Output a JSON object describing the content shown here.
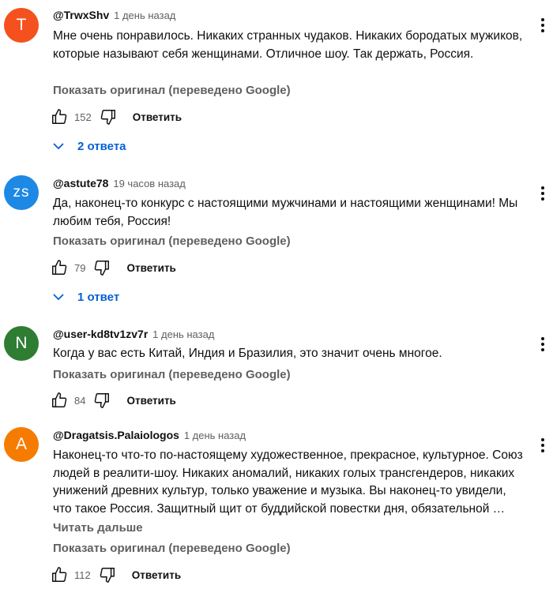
{
  "colors": {
    "link": "#065fd4",
    "muted": "#606060",
    "text": "#0f0f0f"
  },
  "icons": [
    "like-icon",
    "dislike-icon",
    "chevron-down-icon",
    "more-vert-icon"
  ],
  "comments": [
    {
      "avatar_letter": "T",
      "avatar_color": "#f4511e",
      "author": "@TrwxShv",
      "time": "1 день назад",
      "text": "Мне очень понравилось. Никаких странных чудаков. Никаких бородатых мужиков, которые называют себя женщинами. Отличное шоу. Так держать, Россия.",
      "read_more": "",
      "translate": "Показать оригинал (переведено Google)",
      "likes": "152",
      "reply": "Ответить",
      "replies": "2 ответа"
    },
    {
      "avatar_letter": "zs",
      "avatar_color": "#1e88e5",
      "author": "@astute78",
      "time": "19 часов назад",
      "text": "Да, наконец-то конкурс с настоящими мужчинами и настоящими женщинами! Мы любим тебя, Россия!",
      "read_more": "",
      "translate": "Показать оригинал (переведено Google)",
      "likes": "79",
      "reply": "Ответить",
      "replies": "1 ответ"
    },
    {
      "avatar_letter": "N",
      "avatar_color": "#2e7d32",
      "author": "@user-kd8tv1zv7r",
      "time": "1 день назад",
      "text": "Когда у вас есть Китай, Индия и Бразилия, это значит очень многое.",
      "read_more": "",
      "translate": "Показать оригинал (переведено Google)",
      "likes": "84",
      "reply": "Ответить",
      "replies": ""
    },
    {
      "avatar_letter": "A",
      "avatar_color": "#f57c00",
      "author": "@Dragatsis.Palaiologos",
      "time": "1 день назад",
      "text": "Наконец-то что-то по-настоящему художественное, прекрасное, культурное. Союз людей в реалити-шоу. Никаких аномалий, никаких голых трансгендеров, никаких унижений древних культур, только уважение и музыка. Вы наконец-то увидели, что такое Россия. Защитный щит от буддийской повестки дня, обязательной …",
      "read_more": "Читать дальше",
      "translate": "Показать оригинал (переведено Google)",
      "likes": "112",
      "reply": "Ответить",
      "replies": ""
    }
  ]
}
